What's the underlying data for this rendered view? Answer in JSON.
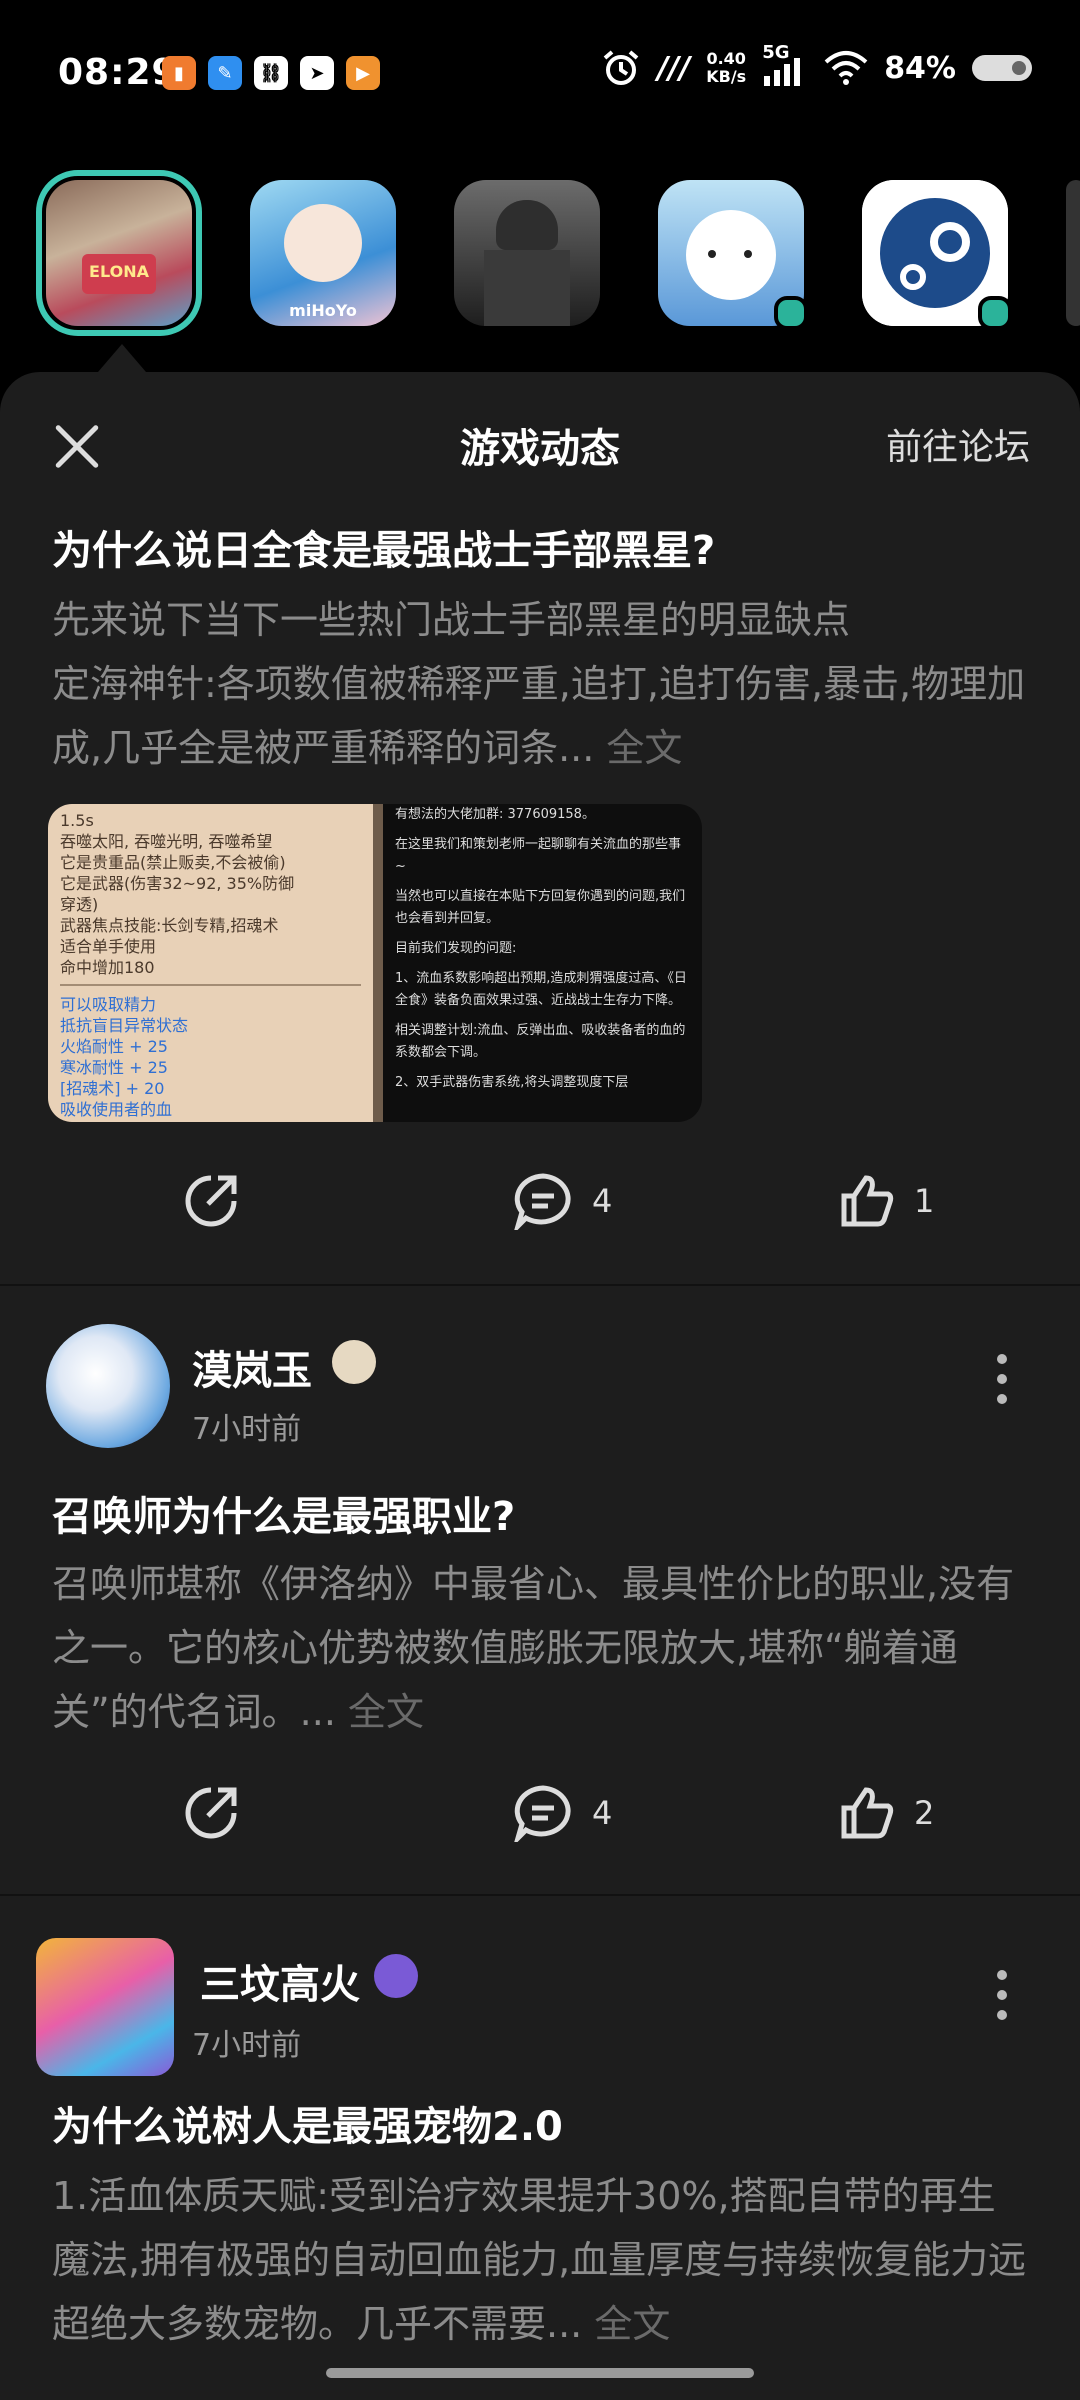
{
  "status_bar": {
    "time": "08:29",
    "net_speed_value": "0.40",
    "net_speed_unit": "KB/s",
    "network": "5G",
    "battery": "84%"
  },
  "apps": [
    {
      "name": "ELONA",
      "label": "ELONA",
      "selected": true
    },
    {
      "name": "miHoYo",
      "label": "miHoYo"
    },
    {
      "name": "shooter-game"
    },
    {
      "name": "polar-bear-app"
    },
    {
      "name": "Steam"
    }
  ],
  "sheet": {
    "title": "游戏动态",
    "forum_link": "前往论坛"
  },
  "posts": [
    {
      "title": "为什么说日全食是最强战士手部黑星?",
      "body": "先来说下当下一些热门战士手部黑星的明显缺点\n定海神针:各项数值被稀释严重,追打,追打伤害,暴击,物理加成,几乎全是被严重稀释的词条...",
      "fulltext": "全文",
      "image_left_lines": [
        "1.5s",
        "吞噬太阳, 吞噬光明, 吞噬希望",
        "它是贵重品(禁止贩卖,不会被偷)",
        "它是武器(伤害32~92, 35%防御",
        "穿透)",
        "武器焦点技能:长剑专精,招魂术",
        "适合单手使用",
        "命中增加180"
      ],
      "image_left_blue": [
        "可以吸取精力",
        "抵抗盲目异常状态",
        "火焰耐性 + 25",
        "寒冰耐性 + 25",
        "[招魂术] + 20",
        "吸收使用者的血"
      ],
      "image_right_lines": [
        "有想法的大佬加群: 377609158。",
        "在这里我们和策划老师一起聊聊有关流血的那些事~",
        "当然也可以直接在本贴下方回复你遇到的问题,我们也会看到并回复。",
        "目前我们发现的问题:",
        "1、流血系数影响超出预期,造成刺猬强度过高、《日全食》装备负面效果过强、近战战士生存力下降。",
        "相关调整计划:流血、反弹出血、吸收装备者的血的系数都会下调。",
        "2、双手武器伤害系统,将头调整现度下层"
      ],
      "comments": "4",
      "likes": "1"
    },
    {
      "author": "漠岚玉",
      "time": "7小时前",
      "title": "召唤师为什么是最强职业?",
      "body": "召唤师堪称《伊洛纳》中最省心、最具性价比的职业,没有之一。它的核心优势被数值膨胀无限放大,堪称“躺着通关”的代名词。...",
      "fulltext": "全文",
      "comments": "4",
      "likes": "2"
    },
    {
      "author": "三坟高火",
      "time": "7小时前",
      "title": "为什么说树人是最强宠物2.0",
      "body": "1.活血体质天赋:受到治疗效果提升30%,搭配自带的再生魔法,拥有极强的自动回血能力,血量厚度与持续恢复能力远超绝大多数宠物。几乎不需要...",
      "fulltext": "全文"
    }
  ]
}
